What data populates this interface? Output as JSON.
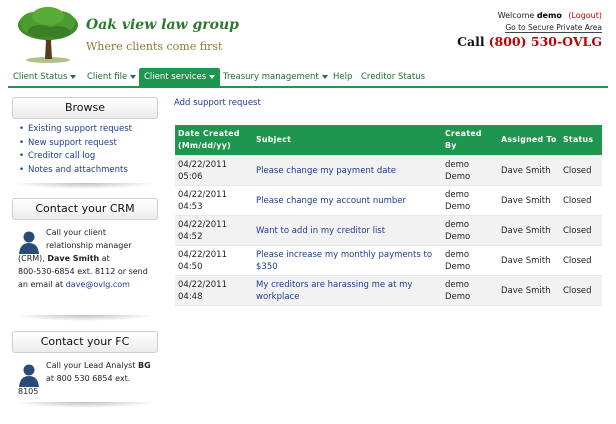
{
  "header": {
    "brand_name": "Oak view law group",
    "tagline": "Where clients come first",
    "welcome_prefix": "Welcome",
    "username": "demo",
    "logout_label": "(Logout)",
    "secure_link": "Go to Secure Private Area",
    "call_label": "Call",
    "phone": "(800) 530-OVLG"
  },
  "nav": {
    "items": [
      {
        "label": "Client Status",
        "dropdown": true
      },
      {
        "label": "Client file",
        "dropdown": true
      },
      {
        "label": "Client services",
        "dropdown": true,
        "active": true
      },
      {
        "label": "Treasury management",
        "dropdown": true
      },
      {
        "label": "Help",
        "dropdown": false
      },
      {
        "label": "Creditor Status",
        "dropdown": false
      }
    ]
  },
  "sidebar": {
    "browse": {
      "title": "Browse",
      "links": [
        "Existing support request",
        "New support request",
        "Creditor call log",
        "Notes and attachments"
      ]
    },
    "crm": {
      "title": "Contact your CRM",
      "line1": "Call your client",
      "line2": "relationship manager",
      "line3_prefix": "(CRM),",
      "name": "Dave Smith",
      "line3_suffix": "at",
      "line4": "800-530-6854 ext. 8112 or send",
      "line5_prefix": "an email at",
      "email": "dave@ovlg.com"
    },
    "fc": {
      "title": "Contact your FC",
      "line1": "Call your Lead Analyst",
      "name": "BG",
      "line2": "at 800 530 6854 ext.",
      "line3": "8105"
    }
  },
  "main": {
    "add_link": "Add support request",
    "columns": [
      "Date Created (Mm/dd/yy)",
      "Subject",
      "Created By",
      "Assigned To",
      "Status"
    ],
    "rows": [
      {
        "date": "04/22/2011",
        "time": "05:06",
        "subject": "Please change my payment date",
        "created_by": "demo Demo",
        "assigned_to": "Dave Smith",
        "status": "Closed"
      },
      {
        "date": "04/22/2011",
        "time": "04:53",
        "subject": "Please change my account number",
        "created_by": "demo Demo",
        "assigned_to": "Dave Smith",
        "status": "Closed"
      },
      {
        "date": "04/22/2011",
        "time": "04:52",
        "subject": "Want to add in my creditor list",
        "created_by": "demo Demo",
        "assigned_to": "Dave Smith",
        "status": "Closed"
      },
      {
        "date": "04/22/2011",
        "time": "04:50",
        "subject": "Please increase my monthly payments to $350",
        "created_by": "demo Demo",
        "assigned_to": "Dave Smith",
        "status": "Closed"
      },
      {
        "date": "04/22/2011",
        "time": "04:48",
        "subject": "My creditors are harassing me at my workplace",
        "created_by": "demo Demo",
        "assigned_to": "Dave Smith",
        "status": "Closed"
      }
    ]
  },
  "colors": {
    "accent_green": "#1e9650",
    "link_blue": "#1a3d8f",
    "phone_red": "#c00000"
  },
  "icons": {
    "logo": "oak-tree-icon",
    "contact": "person-silhouette-icon"
  }
}
